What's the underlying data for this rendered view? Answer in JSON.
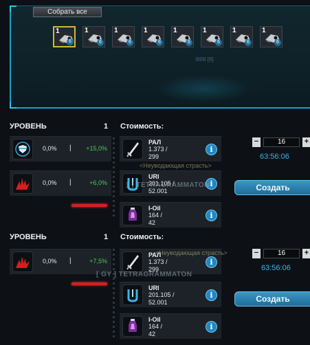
{
  "collect": {
    "button_label": "Собрать все",
    "faint_label": "IIIIIII [6]",
    "items": [
      {
        "tier": "1",
        "count": "6",
        "selected": true
      },
      {
        "tier": "1",
        "count": "6",
        "selected": false
      },
      {
        "tier": "1",
        "count": "6",
        "selected": false
      },
      {
        "tier": "1",
        "count": "6",
        "selected": false
      },
      {
        "tier": "1",
        "count": "6",
        "selected": false
      },
      {
        "tier": "1",
        "count": "6",
        "selected": false
      },
      {
        "tier": "1",
        "count": "6",
        "selected": false
      },
      {
        "tier": "1",
        "count": "6",
        "selected": false
      }
    ]
  },
  "section1": {
    "level_label": "УРОВЕНЬ",
    "level_value": "1",
    "cost_label": "Стоимость:",
    "bonuses": [
      {
        "icon": "shield-icon",
        "current": "0,0%",
        "sep": "|",
        "next": "+15,0%"
      },
      {
        "icon": "claw-icon",
        "current": "0,0%",
        "sep": "|",
        "next": "+6,0%"
      }
    ],
    "resources": [
      {
        "icon": "sword-icon",
        "name": "РАЛ",
        "amount": "1.373 /",
        "total": "299"
      },
      {
        "icon": "uri-icon",
        "name": "URI",
        "amount": "201.105 /",
        "total": "52.001"
      },
      {
        "icon": "oil-icon",
        "name": "I-Oil",
        "amount": "164 /",
        "total": "42"
      }
    ],
    "quantity": "16",
    "timer": "63:56:06",
    "create_label": "Создать"
  },
  "section2": {
    "level_label": "УРОВЕНЬ",
    "level_value": "1",
    "cost_label": "Стоимость:",
    "bonuses": [
      {
        "icon": "claw-icon",
        "current": "0,0%",
        "sep": "|",
        "next": "+7,5%"
      }
    ],
    "resources": [
      {
        "icon": "sword-icon",
        "name": "РАЛ",
        "amount": "1.373 /",
        "total": "299"
      },
      {
        "icon": "uri-icon",
        "name": "URI",
        "amount": "201.105 /",
        "total": "52.001"
      },
      {
        "icon": "oil-icon",
        "name": "I-Oil",
        "amount": "164 /",
        "total": "42"
      }
    ],
    "quantity": "16",
    "timer": "63:56:06",
    "create_label": "Создать"
  },
  "overlays": {
    "sub1": "<Неуводающая страсть>",
    "name1": "[ ] TETRAGRAMMATON",
    "sub2": "<Неуводающая страсть>",
    "name2": "[ GY ] TETRAGRAMMATON"
  },
  "colors": {
    "accent": "#1e9fc7",
    "bonus_green": "#45d04a",
    "timer_blue": "#39b6e8",
    "warning_red": "#d81e1e",
    "selected_gold": "#d6b53a"
  }
}
